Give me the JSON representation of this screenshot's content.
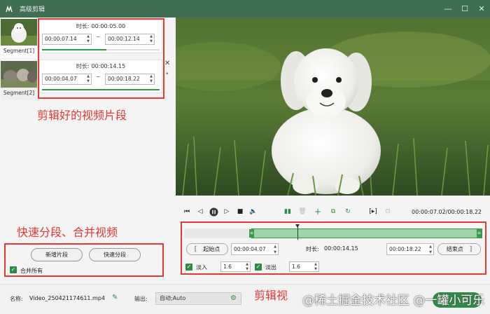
{
  "window": {
    "title": "高级剪辑",
    "minimize_glyph": "—",
    "maximize_glyph": "☐",
    "close_glyph": "✕"
  },
  "segments": [
    {
      "label": "Segment[1]",
      "duration_label": "时长:",
      "duration": "00:00:05.00",
      "start": "00:00:07.14",
      "end": "00:00:12.14",
      "progress": 0.55
    },
    {
      "label": "Segment[2]",
      "duration_label": "时长:",
      "duration": "00:00:14.15",
      "start": "00:00:04.07",
      "end": "00:00:18.22",
      "progress": 1.0
    }
  ],
  "segment_separator": "~",
  "annotations": {
    "clips": "剪辑好的视频片段",
    "split_merge": "快速分段、合并视频",
    "bottom_note": "剪辑视"
  },
  "left_actions": {
    "add_segment": "新增片段",
    "quick_split": "快速分段",
    "merge_all": "合并所有",
    "merge_all_checked": true
  },
  "player": {
    "time_readout": "00:00:07.02/00:00:18.22"
  },
  "timeline": {
    "selection_start_fraction": 0.225,
    "selection_end_fraction": 1.0,
    "playhead_fraction": 0.38
  },
  "trim": {
    "start_button": "起始点",
    "start_time": "00:00:04.07",
    "duration_label": "时长:",
    "duration": "00:00:14.15",
    "end_time": "00:00:18.22",
    "end_button": "结束点",
    "open_bracket": "[",
    "close_bracket": "]"
  },
  "fade": {
    "fade_in_label": "淡入",
    "fade_in_value": "1.6",
    "fade_in_checked": true,
    "fade_out_label": "淡出",
    "fade_out_value": "1.6",
    "fade_out_checked": true
  },
  "bottom": {
    "name_label": "名称:",
    "name_value": "Video_250421174611.mp4",
    "output_label": "输出:",
    "output_value": "自动;Auto",
    "watermark": "@稀土掘金技术社区 @一罐小可乐"
  },
  "colors": {
    "accent": "#3f6f52",
    "annotation": "#e53935",
    "timeline_selection": "#9fd4a8",
    "progress": "#2e9a4a"
  }
}
